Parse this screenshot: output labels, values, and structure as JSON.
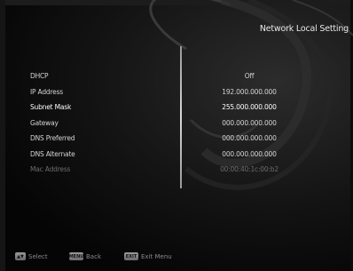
{
  "screen": {
    "title": "Network Local Setting"
  },
  "settings": [
    {
      "label": "DHCP",
      "value": "Off",
      "state": "normal"
    },
    {
      "label": "IP Address",
      "value": "192.000.000.000",
      "state": "normal"
    },
    {
      "label": "Subnet Mask",
      "value": "255.000.000.000",
      "state": "active"
    },
    {
      "label": "Gateway",
      "value": "000.000.000.000",
      "state": "normal"
    },
    {
      "label": "DNS Preferred",
      "value": "000.000.000.000",
      "state": "normal"
    },
    {
      "label": "DNS Alternate",
      "value": "000.000.000.000",
      "state": "normal"
    },
    {
      "label": "Mac Address",
      "value": "00:00:40:1c:00:b2",
      "state": "disabled"
    }
  ],
  "footer": {
    "select": {
      "key": "▲▼",
      "text": "Select",
      "icon": "up-down-arrows-icon"
    },
    "back": {
      "key": "MENU",
      "text": "Back",
      "icon": "menu-key-icon"
    },
    "exit": {
      "key": "EXIT",
      "text": "Exit Menu",
      "icon": "exit-key-icon"
    }
  },
  "colors": {
    "background": "#0a0a0a",
    "text": "#d4d4d4",
    "highlight_text": "#ffffff",
    "disabled_text": "#6c6c6c"
  }
}
